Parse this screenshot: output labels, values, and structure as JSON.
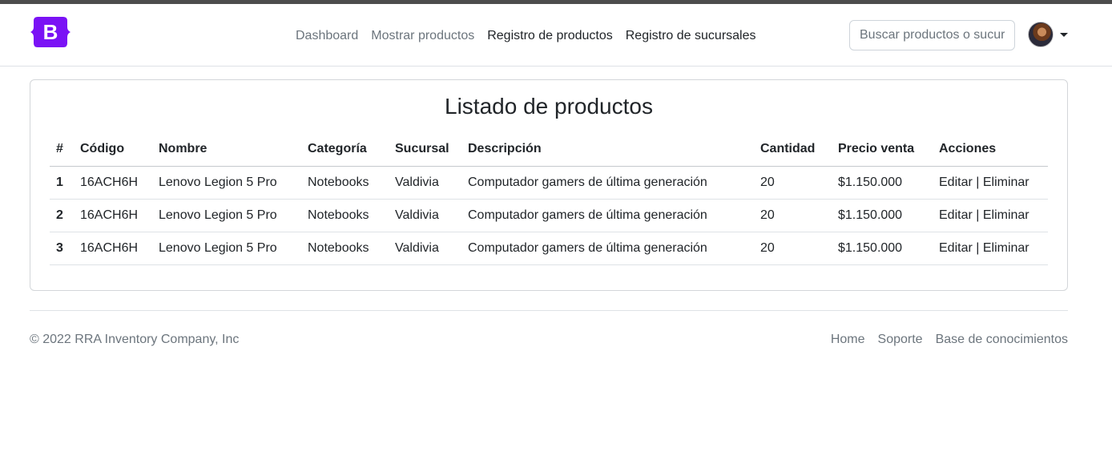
{
  "brand": {
    "letter": "B",
    "color": "#7a12f5"
  },
  "nav": {
    "items": [
      {
        "label": "Dashboard"
      },
      {
        "label": "Mostrar productos"
      },
      {
        "label": "Registro de productos"
      },
      {
        "label": "Registro de sucursales"
      }
    ]
  },
  "search": {
    "placeholder": "Buscar productos o sucursales"
  },
  "main": {
    "title": "Listado de productos",
    "columns": [
      "#",
      "Código",
      "Nombre",
      "Categoría",
      "Sucursal",
      "Descripción",
      "Cantidad",
      "Precio venta",
      "Acciones"
    ],
    "rows": [
      {
        "idx": "1",
        "codigo": "16ACH6H",
        "nombre": "Lenovo Legion 5 Pro",
        "categoria": "Notebooks",
        "sucursal": "Valdivia",
        "descripcion": "Computador gamers de última generación",
        "cantidad": "20",
        "precio": "$1.150.000",
        "edit": "Editar",
        "sep": " | ",
        "delete": "Eliminar"
      },
      {
        "idx": "2",
        "codigo": "16ACH6H",
        "nombre": "Lenovo Legion 5 Pro",
        "categoria": "Notebooks",
        "sucursal": "Valdivia",
        "descripcion": "Computador gamers de última generación",
        "cantidad": "20",
        "precio": "$1.150.000",
        "edit": "Editar",
        "sep": " | ",
        "delete": "Eliminar"
      },
      {
        "idx": "3",
        "codigo": "16ACH6H",
        "nombre": "Lenovo Legion 5 Pro",
        "categoria": "Notebooks",
        "sucursal": "Valdivia",
        "descripcion": "Computador gamers de última generación",
        "cantidad": "20",
        "precio": "$1.150.000",
        "edit": "Editar",
        "sep": " | ",
        "delete": "Eliminar"
      }
    ]
  },
  "footer": {
    "copyright": "© 2022 RRA Inventory Company, Inc",
    "links": [
      {
        "label": "Home"
      },
      {
        "label": "Soporte"
      },
      {
        "label": "Base de conocimientos"
      }
    ]
  }
}
